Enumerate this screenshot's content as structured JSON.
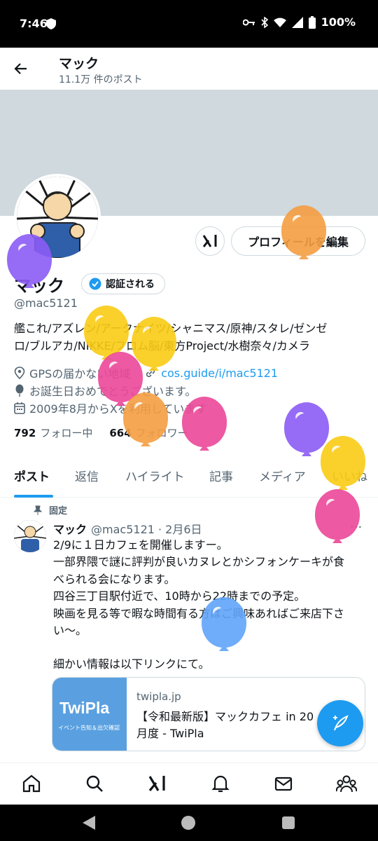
{
  "status_bar": {
    "time": "7:46",
    "battery": "100%"
  },
  "header": {
    "name": "マック",
    "post_count": "11.1万 件のポスト"
  },
  "profile": {
    "name": "マック",
    "verify_label": "認証される",
    "handle": "@mac5121",
    "bio_line1": "艦これ/アズレン/アークナイツ/シャニマス/原神/スタレ/ゼンゼ",
    "bio_line2": "ロ/ブルアカ/NIKKE/フロム脳/東方Project/水樹奈々/カメラ",
    "location": "GPSの届かない地域",
    "website": "cos.guide/i/mac5121",
    "birthday": "お誕生日おめでとうございます。",
    "joined": "2009年8月からXを利用しています",
    "following_count": "792",
    "following_label": "フォロー中",
    "followers_count": "664",
    "followers_label": "フォロワー",
    "edit_profile_label": "プロフィールを編集"
  },
  "tabs": [
    "ポスト",
    "返信",
    "ハイライト",
    "記事",
    "メディア",
    "いいね"
  ],
  "pinned_post": {
    "pinned_label": "固定",
    "author": "マック",
    "handle_date": "@mac5121 · 2月6日",
    "lines": [
      "2/9に１日カフェを開催しますー。",
      "一部界隈で謎に評判が良いカヌレとかシフォンケーキが食",
      "べられる会になります。",
      "四谷三丁目駅付近で、10時から22時までの予定。",
      "映画を見る等で暇な時間有る方はご興味あればご来店下さ",
      "い〜。",
      "",
      "細かい情報は以下リンクにて。"
    ],
    "link_card": {
      "thumb_logo": "TwiPla",
      "thumb_sub": "イベント告知＆出欠確認",
      "domain": "twipla.jp",
      "title_line1": "【令和最新版】マックカフェ in 20",
      "title_line2": "月度 - TwiPla"
    }
  },
  "balloons": [
    {
      "color": "#8b5cf6"
    },
    {
      "color": "#f59e42"
    },
    {
      "color": "#facc15"
    },
    {
      "color": "#facc15"
    },
    {
      "color": "#ec4899"
    },
    {
      "color": "#f59e42"
    },
    {
      "color": "#ec4899"
    },
    {
      "color": "#8b5cf6"
    },
    {
      "color": "#facc15"
    },
    {
      "color": "#ec4899"
    },
    {
      "color": "#60a5fa"
    }
  ]
}
